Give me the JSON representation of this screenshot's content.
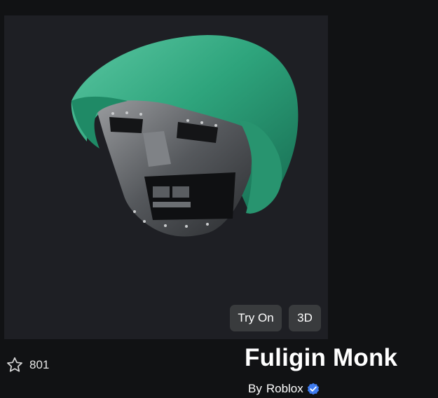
{
  "item": {
    "name": "Fuligin Monk",
    "by_prefix": "By",
    "creator": "Roblox",
    "favorites": "801"
  },
  "preview": {
    "try_on_label": "Try On",
    "view_3d_label": "3D"
  },
  "icons": {
    "favorite": "star-outline-icon",
    "verified": "verified-badge-icon"
  },
  "colors": {
    "background": "#111214",
    "panel": "#1e1f24",
    "button": "#393b3d",
    "verified": "#3f7cf0"
  }
}
